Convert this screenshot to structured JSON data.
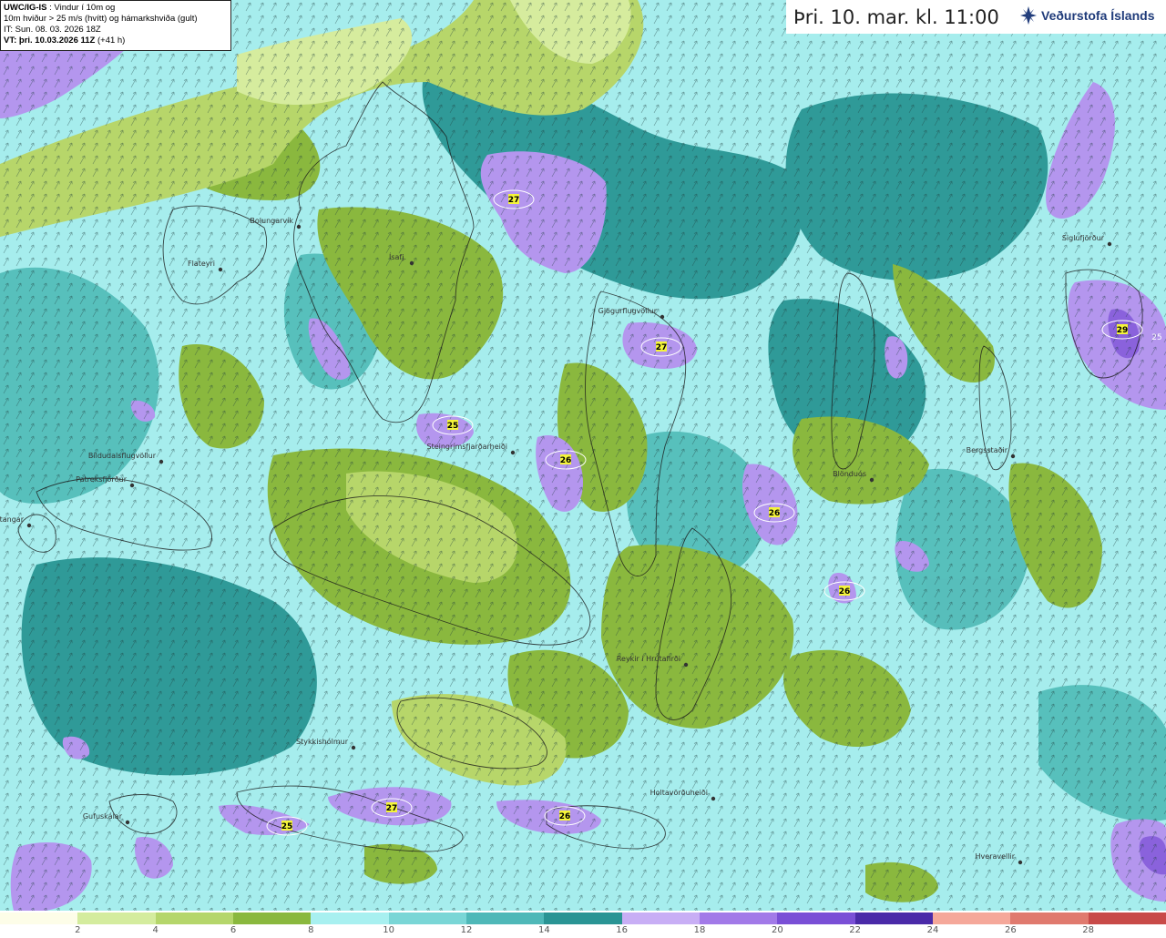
{
  "info": {
    "line1_bold": "UWC/IG-IS",
    "line1_rest": " : Vindur í 10m og",
    "line2": "10m hviður > 25 m/s (hvítt) og hámarkshviða (gult)",
    "line3": "IT: Sun. 08. 03. 2026 18Z",
    "line4_bold": "VT: þri. 10.03.2026 11Z",
    "line4_rest": " (+41 h)"
  },
  "title": "Þri. 10. mar. kl. 11:00",
  "brand": {
    "name": "Veðurstofa Íslands",
    "icon": "vedurstofa-logo-icon",
    "color": "#1f3b7a"
  },
  "legend": {
    "colors": [
      "#fdfde8",
      "#d4ec9e",
      "#b5d66b",
      "#8ab83e",
      "#a8f0f0",
      "#7ad6d6",
      "#4fb8b8",
      "#2a9494",
      "#c8aef5",
      "#a27ae8",
      "#7a4fd6",
      "#4a2aa8",
      "#f5a89a",
      "#e07a6e",
      "#c84a48"
    ],
    "labels": [
      "2",
      "4",
      "6",
      "8",
      "10",
      "12",
      "14",
      "16",
      "18",
      "20",
      "22",
      "24",
      "26",
      "28"
    ]
  },
  "places": [
    {
      "name": "Bolungarvík"
    },
    {
      "name": "Flateyri"
    },
    {
      "name": "Ísafj."
    },
    {
      "name": "Patreksfjörður"
    },
    {
      "name": "Bíldudalsflugvöllur"
    },
    {
      "name": "Bjargtangar"
    },
    {
      "name": "Steingrímsfjarðarheiði"
    },
    {
      "name": "Gjögurflugvöllur"
    },
    {
      "name": "Blönduós"
    },
    {
      "name": "Siglufjörður"
    },
    {
      "name": "Bergsstaðir"
    },
    {
      "name": "Reykir í Hrútafirði"
    },
    {
      "name": "Stykkishólmur"
    },
    {
      "name": "Holtavörðuheiði"
    },
    {
      "name": "Gufuskálar"
    },
    {
      "name": "Hveravellir"
    }
  ],
  "max_gusts": [
    "27",
    "27",
    "25",
    "26",
    "26",
    "26",
    "29",
    "25",
    "27",
    "26",
    "25"
  ]
}
